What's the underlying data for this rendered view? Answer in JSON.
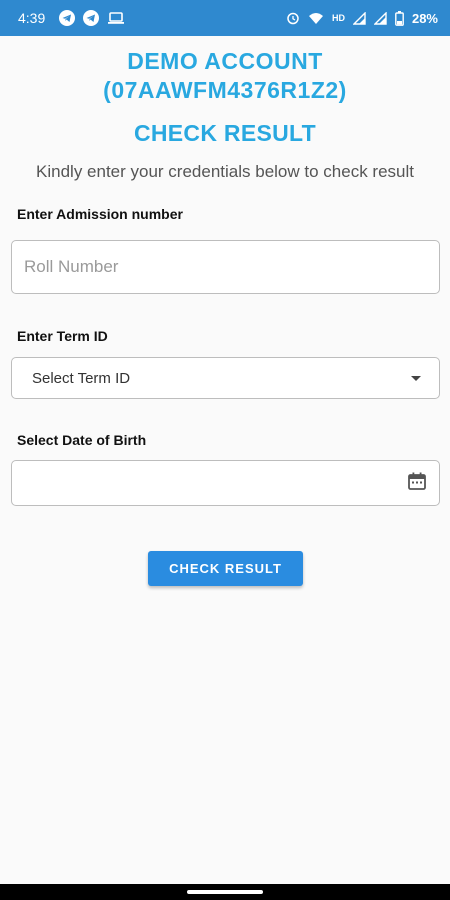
{
  "status_bar": {
    "time": "4:39",
    "network": "HD",
    "battery": "28%",
    "left_icons": [
      "telegram-icon",
      "telegram-icon",
      "laptop-icon"
    ],
    "right_icons": [
      "alarm-icon",
      "wifi-icon",
      "signal-icon",
      "signal-icon",
      "battery-icon"
    ]
  },
  "header": {
    "line1": "DEMO ACCOUNT",
    "line2": "(07AAWFM4376R1Z2)",
    "title": "CHECK RESULT",
    "subtitle": "Kindly enter your credentials below to check result"
  },
  "form": {
    "admission_label": "Enter Admission number",
    "roll_placeholder": "Roll Number",
    "roll_value": "",
    "term_label": "Enter Term ID",
    "term_selected": "Select Term ID",
    "dob_label": "Select Date of Birth",
    "dob_value": "",
    "submit_label": "CHECK RESULT"
  },
  "colors": {
    "accent": "#29a8e0",
    "button": "#2a8ce0",
    "status_bar": "#2f89cf"
  }
}
